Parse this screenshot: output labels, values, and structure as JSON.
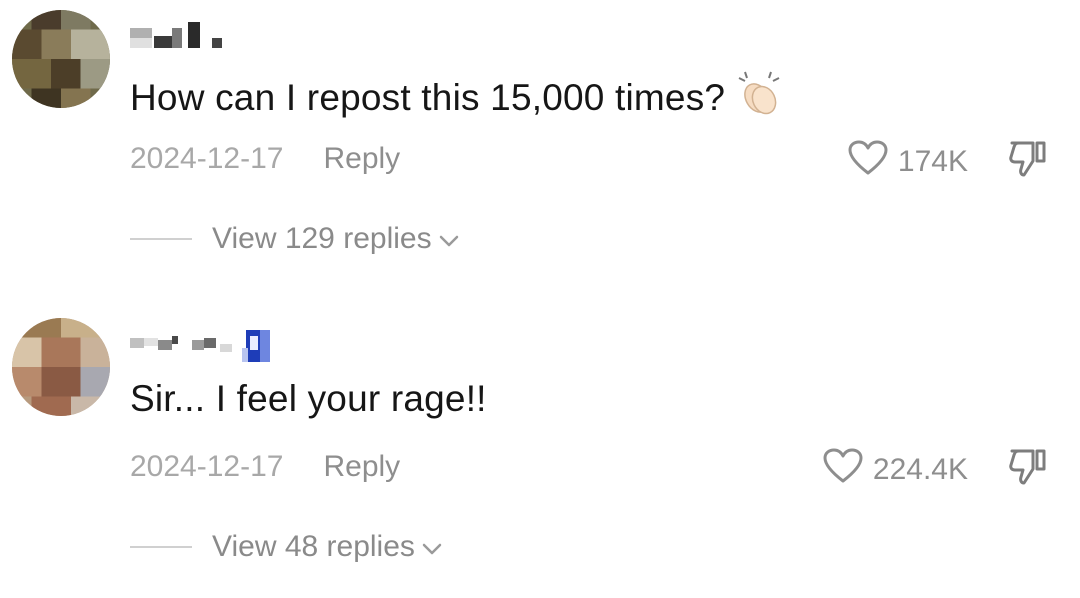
{
  "comments": [
    {
      "text": "How can I repost this 15,000 times?",
      "emoji_icon": "clapping-hands-icon",
      "date": "2024-12-17",
      "reply_label": "Reply",
      "likes": "174K",
      "view_replies": "View 129 replies"
    },
    {
      "text": "Sir... I feel your rage!!",
      "date": "2024-12-17",
      "reply_label": "Reply",
      "likes": "224.4K",
      "view_replies": "View 48 replies"
    }
  ],
  "icons": {
    "like": "heart-outline-icon",
    "dislike": "thumbs-down-icon",
    "expand": "chevron-down-icon"
  },
  "colors": {
    "text": "#161616",
    "secondary": "#8e8e8e",
    "date": "#a8a8a8"
  }
}
